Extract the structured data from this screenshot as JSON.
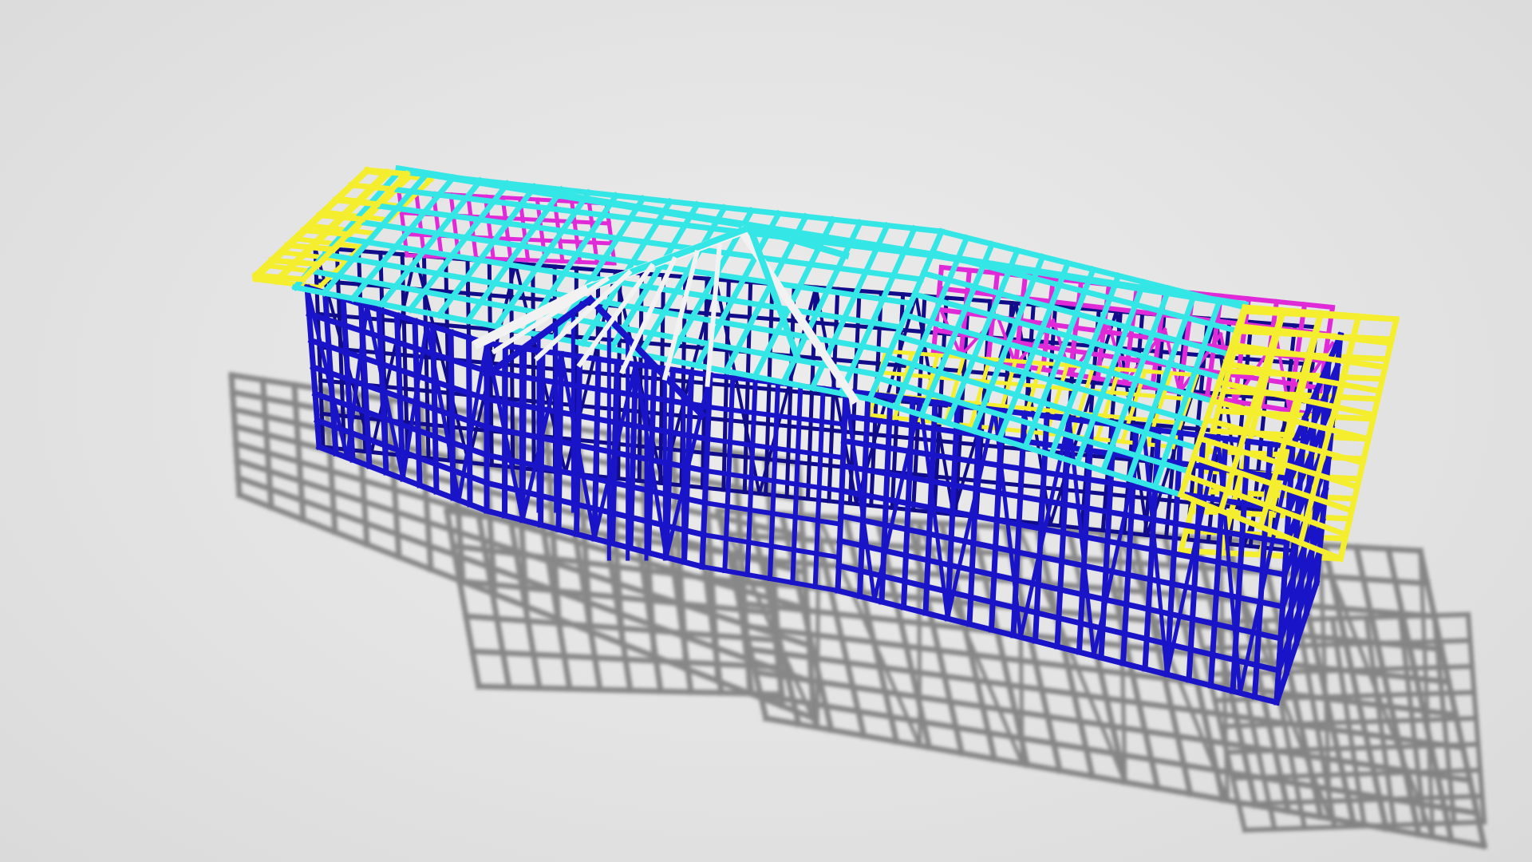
{
  "scene": {
    "background": "#e3e3e3",
    "shadow_color": "#3a3a3a",
    "colors": {
      "wall_frame": "#1a14c8",
      "wall_frame_dark": "#100c8a",
      "rafter": "#35e6e6",
      "ceiling_joist": "#f5ee2e",
      "truss_web": "#e02ad8",
      "ridge_beam": "#f2f2f2"
    },
    "elements": [
      "steel-wall-frame",
      "roof-rafters",
      "eave-overhang",
      "roof-trusses",
      "front-gable",
      "ridge-beams",
      "ground-shadow"
    ]
  }
}
